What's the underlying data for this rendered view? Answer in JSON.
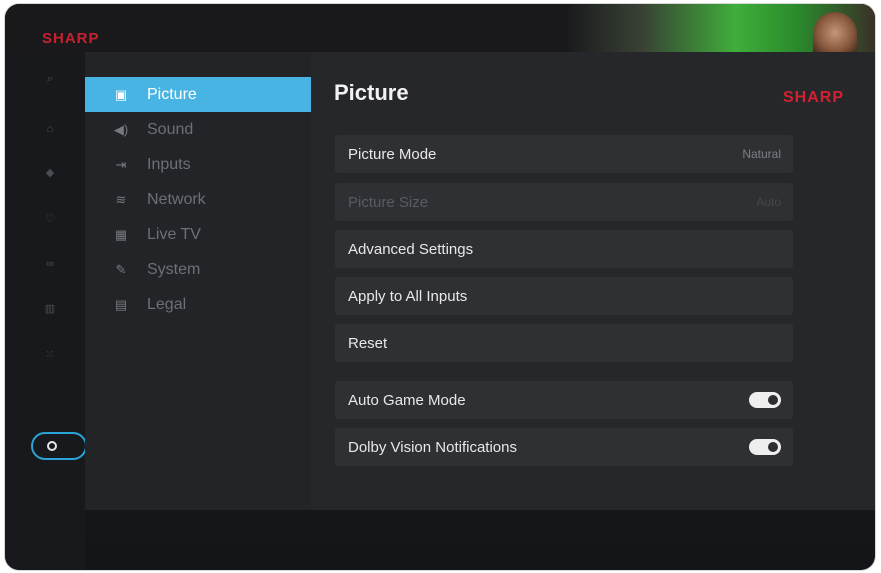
{
  "top": {
    "background_logo": "SHARP"
  },
  "menu": {
    "items": [
      {
        "label": "Picture",
        "icon": "picture-icon",
        "glyph": "▣",
        "active": true
      },
      {
        "label": "Sound",
        "icon": "speaker-icon",
        "glyph": "◀)",
        "active": false
      },
      {
        "label": "Inputs",
        "icon": "input-icon",
        "glyph": "⇥",
        "active": false
      },
      {
        "label": "Network",
        "icon": "wifi-icon",
        "glyph": "≋",
        "active": false
      },
      {
        "label": "Live TV",
        "icon": "tv-grid-icon",
        "glyph": "▦",
        "active": false
      },
      {
        "label": "System",
        "icon": "wrench-icon",
        "glyph": "✎",
        "active": false
      },
      {
        "label": "Legal",
        "icon": "document-icon",
        "glyph": "▤",
        "active": false
      }
    ]
  },
  "content": {
    "title": "Picture",
    "brand": "SHARP",
    "settings": [
      {
        "label": "Picture Mode",
        "value": "Natural"
      },
      {
        "label": "Picture Size",
        "value": "Auto",
        "disabled": true
      },
      {
        "label": "Advanced Settings",
        "value": ""
      },
      {
        "label": "Apply to All Inputs",
        "value": ""
      },
      {
        "label": "Reset",
        "value": ""
      }
    ],
    "toggles": [
      {
        "label": "Auto Game Mode",
        "on": true
      },
      {
        "label": "Dolby Vision Notifications",
        "on": true
      }
    ]
  },
  "colors": {
    "accent": "#48b4e3",
    "brand": "#d3212f",
    "panel": "#26272b",
    "row": "#2f3034"
  }
}
